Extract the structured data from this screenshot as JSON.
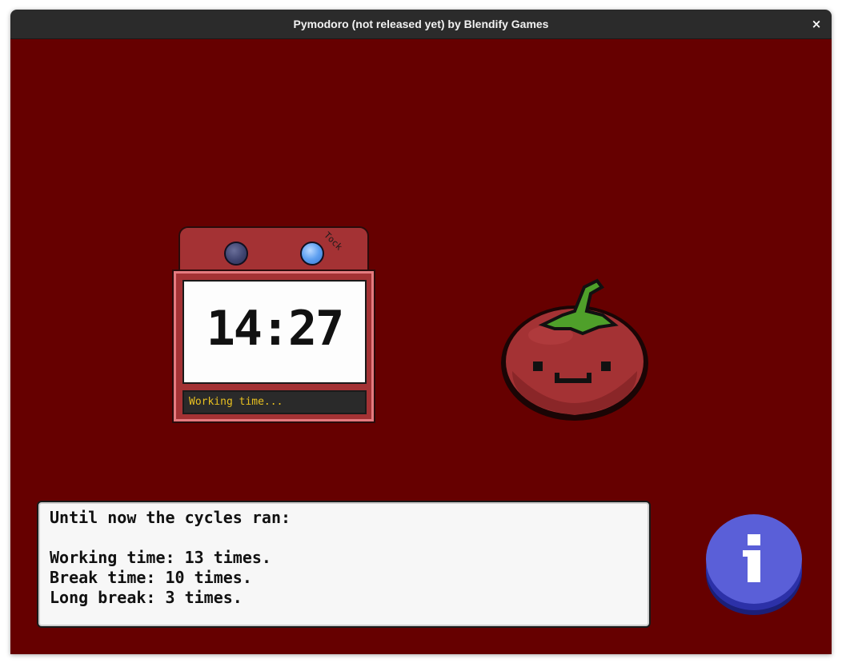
{
  "window": {
    "title": "Pymodoro (not released yet) by Blendify Games",
    "close_label": "×"
  },
  "colors": {
    "background": "#660000",
    "timer_red": "#a43234",
    "status_text": "#e8c020",
    "info_blue": "#5a5fd8"
  },
  "timer": {
    "knob_label": "Tock",
    "time": "14:27",
    "status": "Working time..."
  },
  "mascot": {
    "name": "tomato-icon"
  },
  "stats": {
    "heading": "Until now the cycles ran:",
    "working": "Working time: 13 times.",
    "break": "Break time: 10 times.",
    "long_break": "Long break: 3 times."
  },
  "info_button": {
    "icon": "info-icon"
  }
}
